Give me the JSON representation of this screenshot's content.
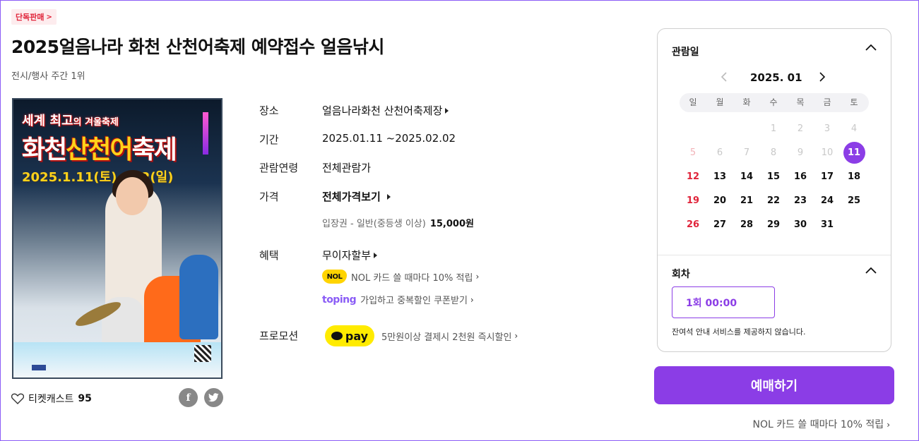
{
  "header": {
    "tag": "단독판매",
    "title": "2025얼음나라 화천 산천어축제 예약접수 얼음낚시",
    "subtitle": "전시/행사 주간 1위"
  },
  "poster": {
    "line1": "세계 최고",
    "line1b": "의 겨울축제",
    "line2a": "화천",
    "line2b": "산천",
    "line2c": "어",
    "line2d": "축제",
    "line3": "2025.1.11(토)~2.2(일)"
  },
  "social": {
    "like_label": "티켓캐스트",
    "like_count": "95",
    "facebook_glyph": "f",
    "twitter_glyph": "t"
  },
  "info": {
    "venue_label": "장소",
    "venue_value": "얼음나라화천 산천어축제장",
    "period_label": "기간",
    "period_value": "2025.01.11 ~2025.02.02",
    "age_label": "관람연령",
    "age_value": "전체관람가",
    "price_label": "가격",
    "price_value": "전체가격보기",
    "price_item": "입장권 - 일반(중등생 이상)",
    "price_amount": "15,000원",
    "benefit_label": "혜택",
    "benefit_value": "무이자할부",
    "nol_badge": "NOL",
    "nol_text": "NOL 카드 쓸 때마다 10% 적립",
    "toping_logo": "toping",
    "toping_text": "가입하고 중복할인 쿠폰받기",
    "promo_label": "프로모션",
    "kpay_logo": "pay",
    "promo_text": "5만원이상 결제시 2천원 즉시할인"
  },
  "calendar": {
    "section_title": "관람일",
    "month": "2025. 01",
    "weekdays": [
      "일",
      "월",
      "화",
      "수",
      "목",
      "금",
      "토"
    ],
    "weeks": [
      [
        "",
        "",
        "",
        "1",
        "2",
        "3",
        "4"
      ],
      [
        "5",
        "6",
        "7",
        "8",
        "9",
        "10",
        "11"
      ],
      [
        "12",
        "13",
        "14",
        "15",
        "16",
        "17",
        "18"
      ],
      [
        "19",
        "20",
        "21",
        "22",
        "23",
        "24",
        "25"
      ],
      [
        "26",
        "27",
        "28",
        "29",
        "30",
        "31",
        ""
      ]
    ],
    "selected": "11",
    "disabled": [
      "1",
      "2",
      "3",
      "4",
      "5",
      "6",
      "7",
      "8",
      "9",
      "10"
    ]
  },
  "session": {
    "section_title": "회차",
    "option": "1회  00:00",
    "note": "잔여석 안내 서비스를 제공하지 않습니다."
  },
  "cta": {
    "book_label": "예매하기",
    "nol_footer": "NOL 카드 쓸 때마다 10% 적립"
  }
}
